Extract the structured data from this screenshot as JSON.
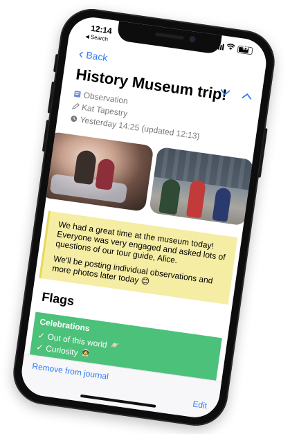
{
  "status_bar": {
    "time": "12:14",
    "back_app": "Search",
    "battery": "89"
  },
  "nav": {
    "back_label": "Back"
  },
  "entry": {
    "title": "History Museum trip!",
    "type": "Observation",
    "author": "Kat Tapestry",
    "date": "Yesterday 14:25 (updated 12:13)",
    "note_paragraphs": [
      "We had a great time at the museum today! Everyone was very engaged and asked lots of questions of our tour guide, Alice.",
      "We'll be posting individual observations and more photos later today 😊"
    ]
  },
  "flags": {
    "heading": "Flags",
    "group": {
      "title": "Celebrations",
      "items": [
        {
          "label": "Out of this world",
          "emoji": "🪐"
        },
        {
          "label": "Curiosity",
          "emoji": "🧑‍🚀"
        }
      ]
    }
  },
  "toolbar": {
    "remove_label": "Remove from journal",
    "edit_label": "Edit"
  },
  "icons": {
    "back": "chevron-left-icon",
    "prev": "chevron-down-icon",
    "next": "chevron-up-icon",
    "type": "observation-icon",
    "author": "pencil-icon",
    "date": "clock-icon"
  },
  "colors": {
    "accent": "#2f7cf6",
    "note_bg": "#f5eda3",
    "flag_bg": "#4cc17a"
  }
}
